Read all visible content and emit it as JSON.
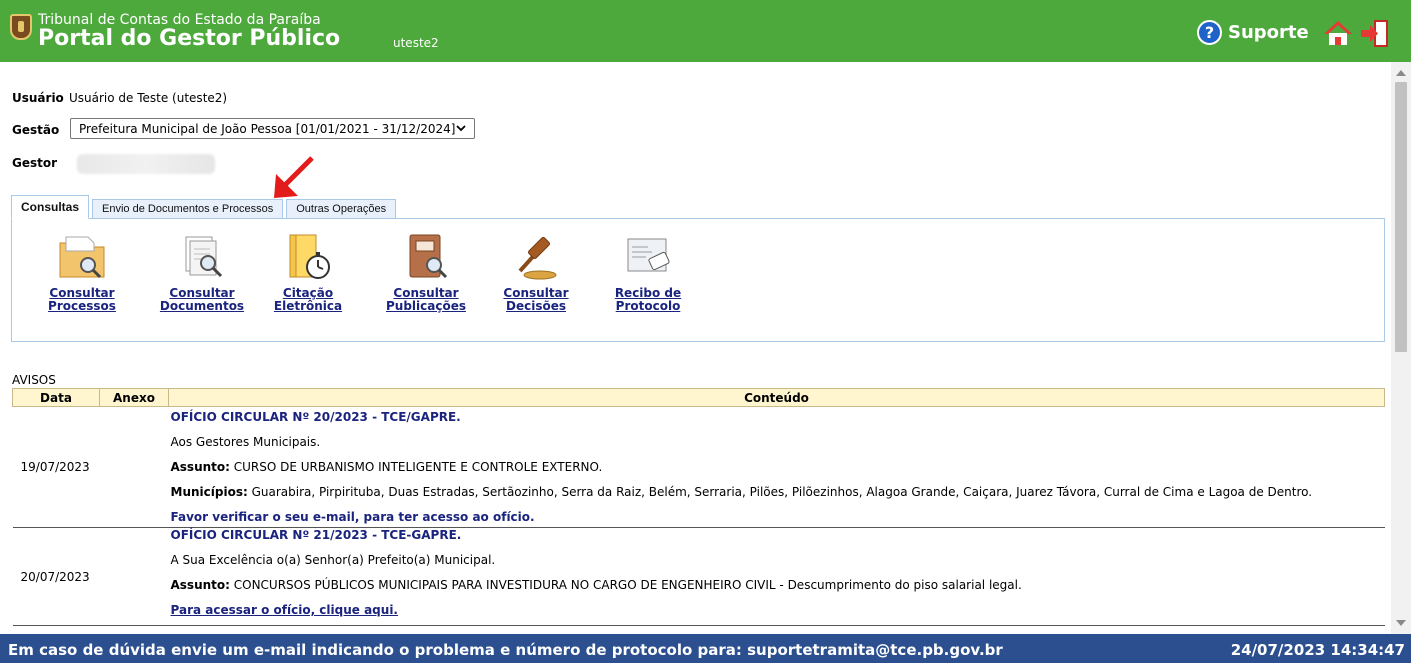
{
  "header": {
    "org": "Tribunal de Contas do Estado da Paraíba",
    "portal": "Portal do Gestor Público",
    "user": "uteste2",
    "support_label": "Suporte",
    "help_glyph": "?"
  },
  "user_info": {
    "usuario_label": "Usuário",
    "usuario_value": "Usuário de Teste (uteste2)",
    "gestao_label": "Gestão",
    "gestao_value": "Prefeitura Municipal de João Pessoa [01/01/2021 - 31/12/2024]",
    "gestor_label": "Gestor"
  },
  "tabs": [
    {
      "label": "Consultas",
      "active": true
    },
    {
      "label": "Envio de Documentos e Processos",
      "active": false
    },
    {
      "label": "Outras Operações",
      "active": false
    }
  ],
  "shortcuts": [
    {
      "line1": "Consultar",
      "line2": "Processos",
      "icon": "folder-search-icon"
    },
    {
      "line1": "Consultar",
      "line2": "Documentos",
      "icon": "document-search-icon"
    },
    {
      "line1": "Citação",
      "line2": "Eletrônica",
      "icon": "folder-stopwatch-icon"
    },
    {
      "line1": "Consultar",
      "line2": "Publicações",
      "icon": "book-search-icon"
    },
    {
      "line1": "Consultar",
      "line2": "Decisões",
      "icon": "gavel-icon"
    },
    {
      "line1": "Recibo de",
      "line2": "Protocolo",
      "icon": "receipt-stamp-icon"
    }
  ],
  "avisos": {
    "title": "AVISOS",
    "columns": [
      "Data",
      "Anexo",
      "Conteúdo"
    ],
    "rows": [
      {
        "date": "19/07/2023",
        "title": "OFÍCIO CIRCULAR Nº 20/2023 - TCE/GAPRE.",
        "greeting": "Aos Gestores Municipais.",
        "assunto_label": "Assunto:",
        "assunto": " CURSO DE URBANISMO INTELIGENTE E CONTROLE EXTERNO.",
        "municipios_label": "Municípios:",
        "municipios": " Guarabira, Pirpirituba, Duas Estradas, Sertãozinho, Serra da Raiz, Belém, Serraria, Pilões, Pilõezinhos, Alagoa Grande, Caiçara, Juarez Távora, Curral de Cima e Lagoa de Dentro.",
        "note": "Favor verificar o seu e-mail, para ter acesso ao ofício."
      },
      {
        "date": "20/07/2023",
        "title": "OFÍCIO CIRCULAR Nº 21/2023 - TCE-GAPRE.",
        "greeting": "A Sua Excelência o(a) Senhor(a) Prefeito(a) Municipal.",
        "assunto_label": "Assunto:",
        "assunto": " CONCURSOS PÚBLICOS MUNICIPAIS PARA INVESTIDURA NO CARGO DE ENGENHEIRO CIVIL - Descumprimento do piso salarial legal.",
        "link": "Para acessar o ofício, clique aqui."
      }
    ]
  },
  "footer": {
    "message": "Em caso de dúvida envie um e-mail indicando o problema e número de protocolo para: suportetramita@tce.pb.gov.br",
    "datetime": "24/07/2023 14:34:47"
  },
  "colors": {
    "header_bg": "#4ea93d",
    "footer_bg": "#2b4f8f",
    "link": "#1a237e",
    "table_header_bg": "#fff6cf"
  }
}
